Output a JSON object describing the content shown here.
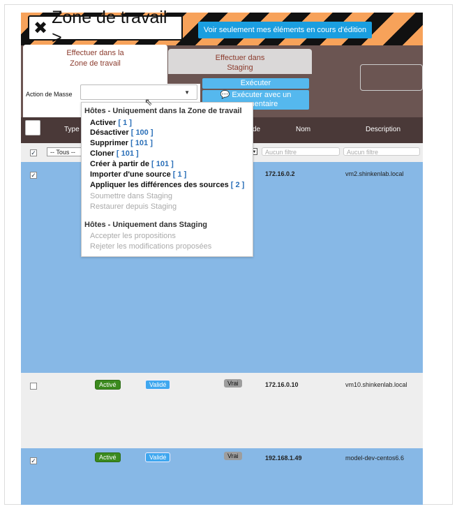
{
  "header": {
    "title": "Zone de travail >",
    "own_items_button": "Voir seulement mes éléments en cours d'édition"
  },
  "tabs": [
    {
      "label_line1": "Effectuer dans la",
      "label_line2": "Zone de travail",
      "active": true
    },
    {
      "label_line1": "Effectuer dans",
      "label_line2": "Staging",
      "active": false
    }
  ],
  "mass_action": {
    "label": "Action de Masse",
    "value": "",
    "execute_label": "Exécuter",
    "execute_comment_line1": "Exécuter avec un",
    "execute_comment_line2": "commentaire"
  },
  "table": {
    "columns": {
      "type": "Type",
      "code": "de",
      "name": "Nom",
      "description": "Description"
    },
    "filters": {
      "type": "-- Tous --",
      "name_placeholder": "Aucun filtre",
      "description_placeholder": "Aucun filtre"
    },
    "rows": [
      {
        "checked": true,
        "enabled": "",
        "status": "",
        "flag": "",
        "name": "172.16.0.2",
        "description": "vm2.shinkenlab.local"
      },
      {
        "checked": false,
        "enabled": "Activé",
        "status": "Validé",
        "flag": "Vrai",
        "name": "172.16.0.10",
        "description": "vm10.shinkenlab.local"
      },
      {
        "checked": true,
        "enabled": "Activé",
        "status": "Validé",
        "flag": "Vrai",
        "name": "192.168.1.49",
        "description": "model-dev-centos6.6"
      }
    ]
  },
  "dropdown": {
    "group1": "Hôtes - Uniquement dans la Zone de travail",
    "items": [
      {
        "label": "Activer",
        "count": "[ 1 ]"
      },
      {
        "label": "Désactiver",
        "count": "[ 100 ]"
      },
      {
        "label": "Supprimer",
        "count": "[ 101 ]"
      },
      {
        "label": "Cloner",
        "count": "[ 101 ]"
      },
      {
        "label": "Créer à partir de",
        "count": "[ 101 ]"
      },
      {
        "label": "Importer d'une source",
        "count": "[ 1 ]"
      },
      {
        "label": "Appliquer les différences des sources",
        "count": "[ 2 ]"
      }
    ],
    "disabled1": [
      "Soumettre dans Staging",
      "Restaurer depuis Staging"
    ],
    "group2": "Hôtes - Uniquement dans Staging",
    "disabled2": [
      "Accepter les propositions",
      "Rejeter les modifications proposées"
    ]
  },
  "icons": {
    "tools": "tools-icon",
    "comment": "comment-icon",
    "broom": "broom-icon"
  },
  "colors": {
    "accent_blue": "#1a9ee0",
    "row_blue": "#87b8e6",
    "header_brown": "#4a3938",
    "stripe_orange": "#f7a25a"
  }
}
